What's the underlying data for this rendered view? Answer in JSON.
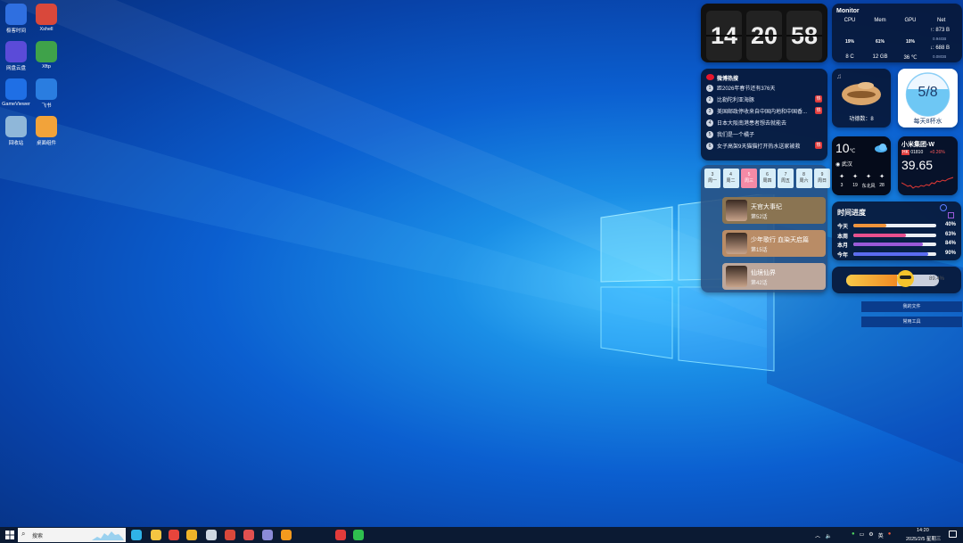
{
  "desktop_icons": [
    {
      "label": "极客时间",
      "icon": "app-icon",
      "color": "#2f6fe0"
    },
    {
      "label": "Xshell",
      "icon": "xshell-icon",
      "color": "#d9483b"
    },
    {
      "label": "网盘云盘",
      "icon": "cloud-drive-icon",
      "color": "#5b4bd8"
    },
    {
      "label": "Xftp",
      "icon": "xftp-icon",
      "color": "#3fa24a"
    },
    {
      "label": "GameViewer",
      "icon": "gameviewer-icon",
      "color": "#1f6fe5"
    },
    {
      "label": "飞书",
      "icon": "feishu-icon",
      "color": "#2a7de0"
    },
    {
      "label": "回收站",
      "icon": "recycle-bin-icon",
      "color": "#8fb7d9"
    },
    {
      "label": "桌面组件",
      "icon": "desktop-widget-icon",
      "color": "#f2a33a"
    }
  ],
  "clock": {
    "h": "14",
    "m": "20",
    "s": "58"
  },
  "monitor": {
    "title": "Monitor",
    "cols": [
      {
        "label": "CPU",
        "pct": "19%",
        "val": 19,
        "bottom": "8 C",
        "color": "#3fb0ff"
      },
      {
        "label": "Mem",
        "pct": "61%",
        "val": 61,
        "bottom": "12 GB",
        "color": "#38c172"
      },
      {
        "label": "GPU",
        "pct": "10%",
        "val": 10,
        "bottom": "36 ℃",
        "color": "#3fb0ff"
      }
    ],
    "net": {
      "label": "Net",
      "up": "↑: 873 B",
      "up_total": "0.94GB",
      "down": "↓: 688 B",
      "down_total": "0.08GB"
    }
  },
  "news": {
    "title": "微博热搜",
    "items": [
      {
        "n": "1",
        "text": "距2026年春节还有376天",
        "hot": false
      },
      {
        "n": "2",
        "text": "比勒陀利亚海豚",
        "hot": true
      },
      {
        "n": "3",
        "text": "美国邮政停收来自中国内地和中国香...",
        "hot": true
      },
      {
        "n": "4",
        "text": "日本大阪南港患者想去就能去",
        "hot": false
      },
      {
        "n": "5",
        "text": "我们是一个橘子",
        "hot": false
      },
      {
        "n": "6",
        "text": "女子高架9天猫猫打开热水送家被救",
        "hot": true
      }
    ],
    "hot_label": "热"
  },
  "merit": {
    "label": "功德数：8"
  },
  "water": {
    "value": "5/8",
    "fill": 0.625,
    "label": "每天8杯水"
  },
  "weather": {
    "temp": "10",
    "unit": "℃",
    "city": "武汉",
    "stats": [
      {
        "icon": "wind-icon",
        "val": "3"
      },
      {
        "icon": "turbine-icon",
        "val": "19"
      },
      {
        "icon": "building-icon",
        "val": "东北风"
      },
      {
        "icon": "bug-icon",
        "val": "28"
      }
    ]
  },
  "stock": {
    "name": "小米集团-W",
    "code": "01810",
    "change": "+0.26%",
    "price": "39.65"
  },
  "calendar": {
    "days": [
      {
        "d": "3",
        "w": "周一"
      },
      {
        "d": "4",
        "w": "周二"
      },
      {
        "d": "5",
        "w": "周三"
      },
      {
        "d": "6",
        "w": "周四"
      },
      {
        "d": "7",
        "w": "周五"
      },
      {
        "d": "8",
        "w": "周六"
      },
      {
        "d": "9",
        "w": "周日"
      }
    ],
    "today": 2
  },
  "anime": [
    {
      "title": "天官大事纪",
      "ep": "第52话",
      "bg": "#8a7452"
    },
    {
      "title": "少年歌行 血染天启篇",
      "ep": "第15话",
      "bg": "#b98c66"
    },
    {
      "title": "仙境仙界",
      "ep": "第42话",
      "bg": "#bda79b"
    }
  ],
  "progress": {
    "title": "时间进度",
    "rows": [
      {
        "label": "今天",
        "pct": "40%",
        "val": 0.4,
        "color": "#f0943b"
      },
      {
        "label": "本周",
        "pct": "63%",
        "val": 0.63,
        "color": "#e8508e"
      },
      {
        "label": "本月",
        "pct": "84%",
        "val": 0.84,
        "color": "#9b59d9"
      },
      {
        "label": "今年",
        "pct": "90%",
        "val": 0.9,
        "color": "#5b6cf0"
      }
    ]
  },
  "battery": {
    "label": "89.4%",
    "val": 0.55
  },
  "buttons": {
    "files": "我的文件",
    "tools": "常用工具"
  },
  "taskbar": {
    "search": "搜索",
    "ime": "英",
    "time": "14:20",
    "date": "2025/2/5 星期三"
  }
}
